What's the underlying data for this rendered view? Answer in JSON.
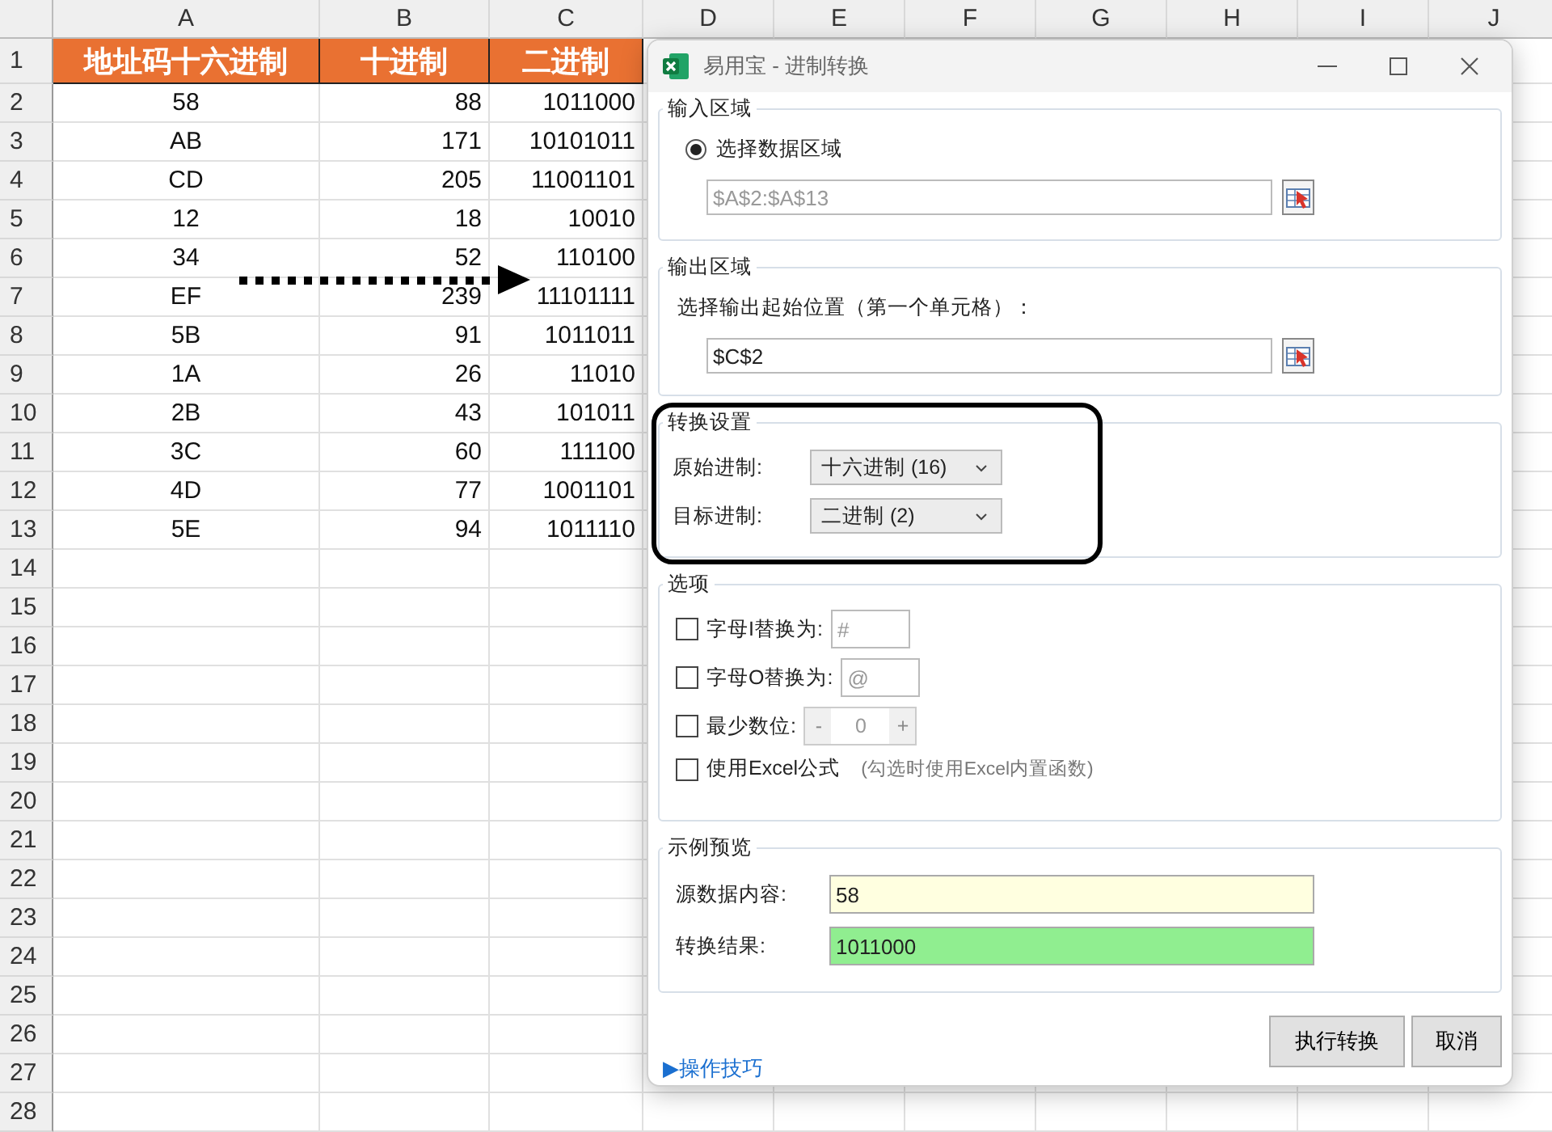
{
  "spreadsheet": {
    "columns": [
      "A",
      "B",
      "C",
      "D",
      "E",
      "F",
      "G",
      "H",
      "I",
      "J"
    ],
    "row_numbers": [
      "1",
      "2",
      "3",
      "4",
      "5",
      "6",
      "7",
      "8",
      "9",
      "10",
      "11",
      "12",
      "13",
      "14",
      "15",
      "16",
      "17",
      "18",
      "19",
      "20",
      "21",
      "22",
      "23",
      "24",
      "25",
      "26",
      "27",
      "28"
    ],
    "header_row": [
      "地址码十六进制",
      "十进制",
      "二进制"
    ],
    "rows": [
      [
        "58",
        "88",
        "1011000"
      ],
      [
        "AB",
        "171",
        "10101011"
      ],
      [
        "CD",
        "205",
        "11001101"
      ],
      [
        "12",
        "18",
        "10010"
      ],
      [
        "34",
        "52",
        "110100"
      ],
      [
        "EF",
        "239",
        "11101111"
      ],
      [
        "5B",
        "91",
        "1011011"
      ],
      [
        "1A",
        "26",
        "11010"
      ],
      [
        "2B",
        "43",
        "101011"
      ],
      [
        "3C",
        "60",
        "111100"
      ],
      [
        "4D",
        "77",
        "1001101"
      ],
      [
        "5E",
        "94",
        "1011110"
      ]
    ]
  },
  "dialog": {
    "title": "易用宝 - 进制转换",
    "input_area": {
      "title": "输入区域",
      "radio_label": "选择数据区域",
      "selected": true,
      "range": "$A$2:$A$13",
      "disabled": true
    },
    "output_area": {
      "title": "输出区域",
      "prompt": "选择输出起始位置（第一个单元格）：",
      "value": "$C$2"
    },
    "conversion": {
      "title": "转换设置",
      "source_label": "原始进制:",
      "source_value": "十六进制 (16)",
      "target_label": "目标进制:",
      "target_value": "二进制 (2)"
    },
    "options": {
      "title": "选项",
      "items": [
        {
          "kind": "replace",
          "label": "字母I替换为:",
          "checked": false,
          "value": "#"
        },
        {
          "kind": "replace",
          "label": "字母O替换为:",
          "checked": false,
          "value": "@"
        },
        {
          "kind": "spinner",
          "label": "最少数位:",
          "checked": false,
          "minus": "-",
          "value": "0",
          "plus": "+"
        },
        {
          "kind": "note",
          "label": "使用Excel公式",
          "checked": false,
          "note": "(勾选时使用Excel内置函数)"
        }
      ]
    },
    "preview": {
      "title": "示例预览",
      "source_label": "源数据内容:",
      "source_value": "58",
      "result_label": "转换结果:",
      "result_value": "1011000"
    },
    "buttons": [
      "执行转换",
      "取消"
    ],
    "help_link": "▶操作技巧"
  }
}
